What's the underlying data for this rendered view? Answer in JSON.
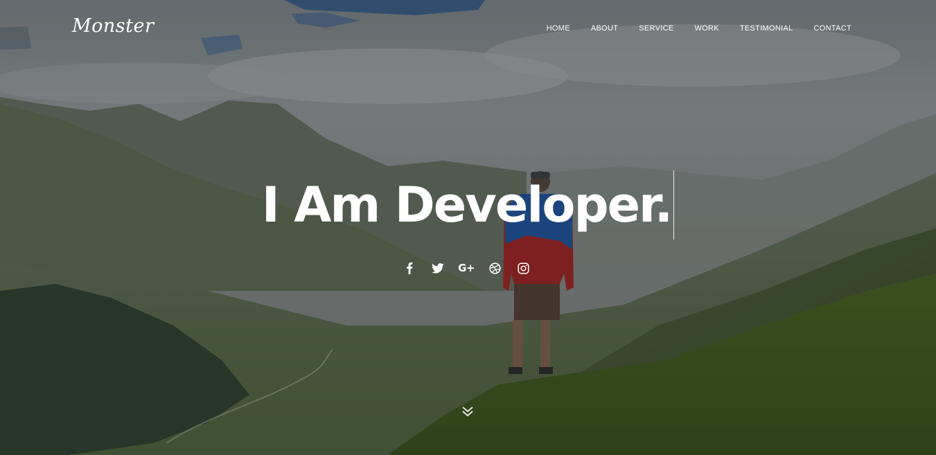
{
  "site": {
    "logo": "Monster"
  },
  "nav": {
    "items": [
      {
        "label": "HOME"
      },
      {
        "label": "ABOUT"
      },
      {
        "label": "SERVICE"
      },
      {
        "label": "WORK"
      },
      {
        "label": "TESTIMONIAL"
      },
      {
        "label": "CONTACT"
      }
    ]
  },
  "hero": {
    "headline": "I Am Developer."
  },
  "social": {
    "icons": [
      "facebook-icon",
      "twitter-icon",
      "google-plus-icon",
      "dribbble-icon",
      "instagram-icon"
    ],
    "google_plus_glyph": "G+"
  },
  "scroll": {
    "icon": "double-chevron-down-icon"
  },
  "colors": {
    "text": "#ffffff",
    "overlay": "#1e1e1e"
  }
}
